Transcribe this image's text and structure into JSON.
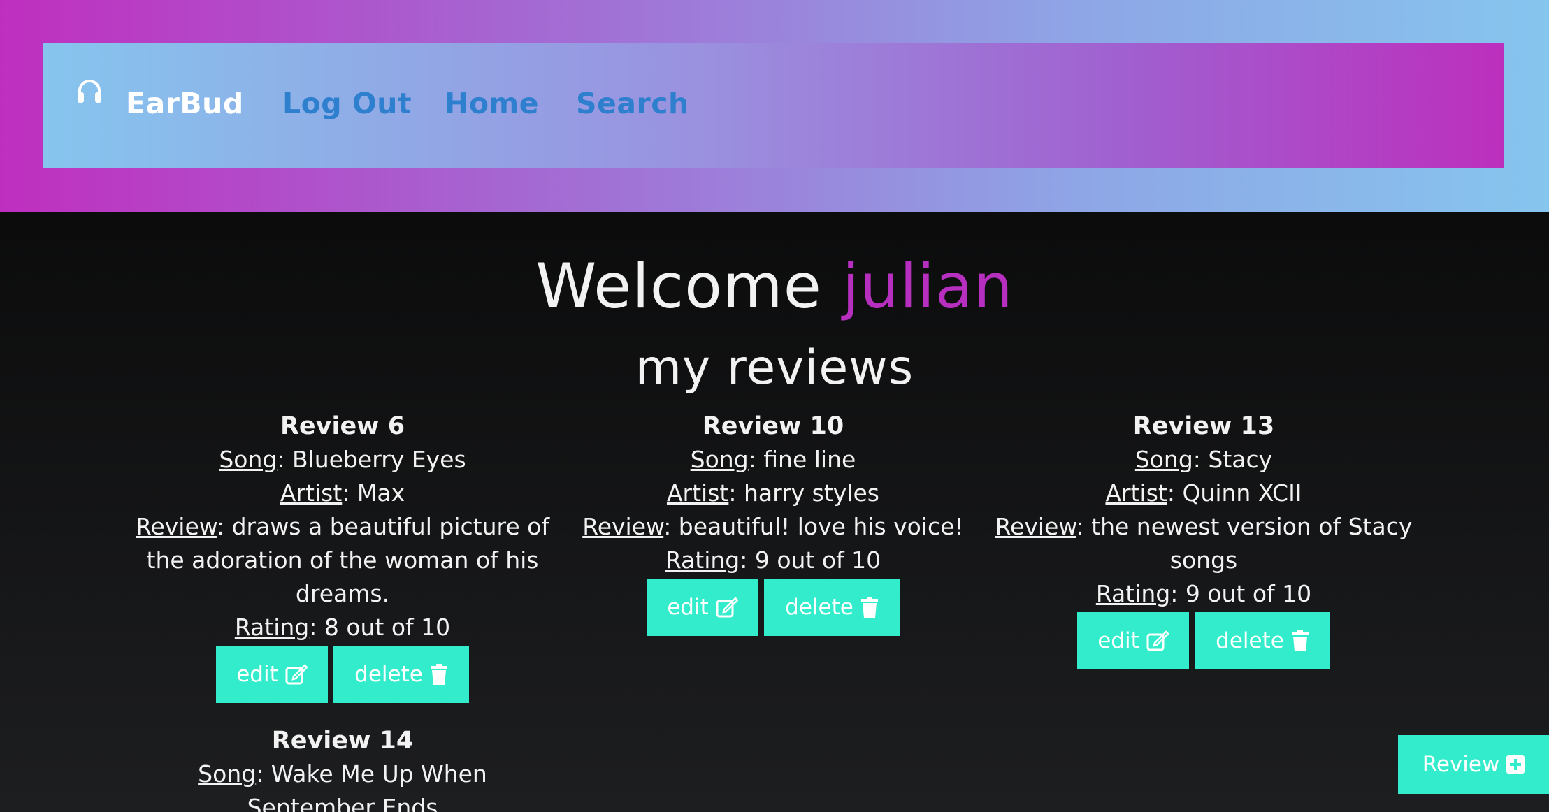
{
  "nav": {
    "brand": "EarBud",
    "links": [
      "Log Out",
      "Home",
      "Search"
    ]
  },
  "welcome": {
    "greeting": "Welcome",
    "username": "julian"
  },
  "section_title": "my reviews",
  "field_labels": {
    "song": "Song",
    "artist": "Artist",
    "review": "Review",
    "rating": "Rating"
  },
  "reviews": [
    {
      "title": "Review 6",
      "song": "Blueberry Eyes",
      "artist": "Max",
      "review": "draws a beautiful picture of the adoration of the woman of his dreams.",
      "rating": "8 out of 10"
    },
    {
      "title": "Review 10",
      "song": "fine line",
      "artist": "harry styles",
      "review": "beautiful! love his voice!",
      "rating": "9 out of 10"
    },
    {
      "title": "Review 13",
      "song": "Stacy",
      "artist": "Quinn XCII",
      "review": "the newest version of Stacy songs",
      "rating": "9 out of 10"
    },
    {
      "title": "Review 14",
      "song": "Wake Me Up When September Ends"
    }
  ],
  "buttons": {
    "edit": "edit",
    "delete": "delete",
    "add_review": "Review"
  },
  "icons": {
    "brand": "headphones-icon",
    "edit": "edit-icon",
    "delete": "trash-icon",
    "add": "plus-square-icon"
  },
  "colors": {
    "accent": "#32eccb",
    "username": "#b62fbf",
    "nav_link": "#2f7fcf"
  }
}
